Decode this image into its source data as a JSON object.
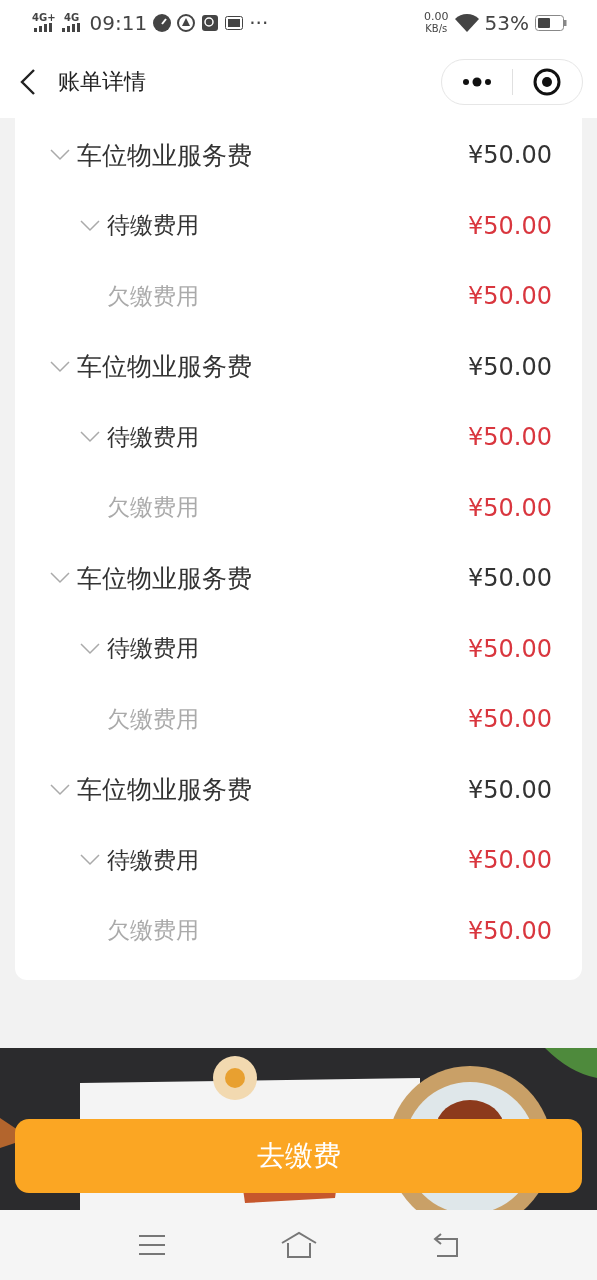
{
  "status_bar": {
    "signal_1": "4G+",
    "signal_2": "4G",
    "time": "09:11",
    "more": "···",
    "speed": "0.00",
    "speed_unit": "KB/s",
    "battery": "53%"
  },
  "header": {
    "title": "账单详情"
  },
  "fees": [
    {
      "label": "车位物业服务费",
      "amount": "¥50.00",
      "expanded": true,
      "children": [
        {
          "label": "待缴费用",
          "amount": "¥50.00",
          "expanded": true,
          "children": [
            {
              "label": "欠缴费用",
              "amount": "¥50.00"
            }
          ]
        }
      ]
    },
    {
      "label": "车位物业服务费",
      "amount": "¥50.00",
      "expanded": true,
      "children": [
        {
          "label": "待缴费用",
          "amount": "¥50.00",
          "expanded": true,
          "children": [
            {
              "label": "欠缴费用",
              "amount": "¥50.00"
            }
          ]
        }
      ]
    },
    {
      "label": "车位物业服务费",
      "amount": "¥50.00",
      "expanded": true,
      "children": [
        {
          "label": "待缴费用",
          "amount": "¥50.00",
          "expanded": true,
          "children": [
            {
              "label": "欠缴费用",
              "amount": "¥50.00"
            }
          ]
        }
      ]
    },
    {
      "label": "车位物业服务费",
      "amount": "¥50.00",
      "expanded": true,
      "children": [
        {
          "label": "待缴费用",
          "amount": "¥50.00",
          "expanded": true,
          "children": [
            {
              "label": "欠缴费用",
              "amount": "¥50.00"
            }
          ]
        }
      ]
    }
  ],
  "pay_button": "去缴费"
}
